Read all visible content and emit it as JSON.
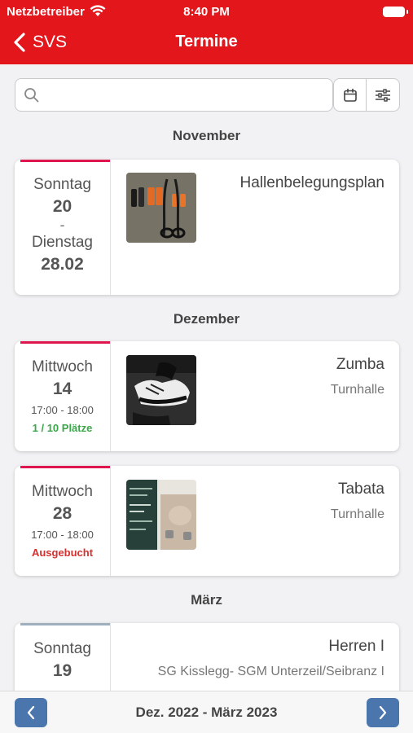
{
  "status_bar": {
    "carrier": "Netzbetreiber",
    "time": "8:40 PM"
  },
  "nav": {
    "back_label": "SVS",
    "title": "Termine"
  },
  "search": {
    "placeholder": "",
    "value": ""
  },
  "groups": [
    {
      "month": "November",
      "events": [
        {
          "start_weekday": "Sonntag",
          "start_day": "20",
          "separator": "-",
          "end_weekday": "Dienstag",
          "end_date": "28.02",
          "title": "Hallenbelegungsplan",
          "thumbnail": "fitness-equipment-photo"
        }
      ]
    },
    {
      "month": "Dezember",
      "events": [
        {
          "weekday": "Mittwoch",
          "day": "14",
          "time": "17:00 - 18:00",
          "status": "1 / 10 Plätze",
          "status_color": "#3aa64a",
          "title": "Zumba",
          "location": "Turnhalle",
          "thumbnail": "sneakers-photo"
        },
        {
          "weekday": "Mittwoch",
          "day": "28",
          "time": "17:00 - 18:00",
          "status": "Ausgebucht",
          "status_color": "#d6302f",
          "title": "Tabata",
          "location": "Turnhalle",
          "thumbnail": "workout-flyer-photo"
        }
      ]
    },
    {
      "month": "März",
      "events": [
        {
          "weekday": "Sonntag",
          "day": "19",
          "title": "Herren I",
          "location": "SG Kisslegg- SGM Unterzeil/Seibranz I"
        }
      ]
    }
  ],
  "footer": {
    "range": "Dez. 2022 - März 2023"
  },
  "colors": {
    "brand": "#e3161c",
    "accent": "#e0174f",
    "pager": "#4b76ad"
  }
}
